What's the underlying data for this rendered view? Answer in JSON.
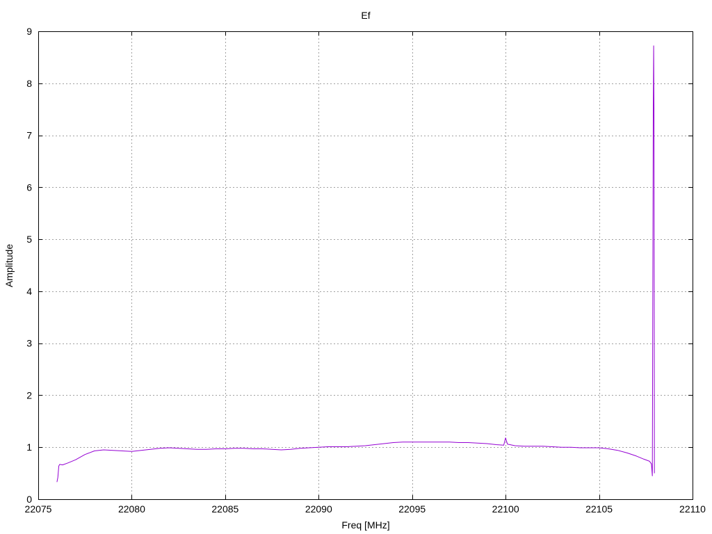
{
  "chart_data": {
    "type": "line",
    "title": "Ef",
    "xlabel": "Freq [MHz]",
    "ylabel": "Amplitude",
    "xlim": [
      22075,
      22110
    ],
    "ylim": [
      0,
      9
    ],
    "xticks": [
      22075,
      22080,
      22085,
      22090,
      22095,
      22100,
      22105,
      22110
    ],
    "yticks": [
      0,
      1,
      2,
      3,
      4,
      5,
      6,
      7,
      8,
      9
    ],
    "grid": true,
    "legend": "none",
    "series": [
      {
        "color": "#9400d3",
        "x": [
          22076.0,
          22076.05,
          22076.1,
          22076.15,
          22076.3,
          22076.6,
          22077.0,
          22077.5,
          22078.0,
          22078.5,
          22079.0,
          22079.5,
          22080.0,
          22080.5,
          22081.0,
          22081.5,
          22082.0,
          22082.5,
          22083.0,
          22083.5,
          22084.0,
          22084.5,
          22085.0,
          22085.5,
          22086.0,
          22086.5,
          22087.0,
          22087.5,
          22088.0,
          22088.5,
          22089.0,
          22089.5,
          22090.0,
          22090.5,
          22091.0,
          22091.5,
          22092.0,
          22092.5,
          22093.0,
          22093.5,
          22094.0,
          22094.5,
          22095.0,
          22095.5,
          22096.0,
          22096.5,
          22097.0,
          22097.5,
          22098.0,
          22098.5,
          22099.0,
          22099.5,
          22099.9,
          22100.0,
          22100.1,
          22100.5,
          22101.0,
          22101.5,
          22102.0,
          22102.5,
          22103.0,
          22103.5,
          22104.0,
          22104.5,
          22105.0,
          22105.5,
          22106.0,
          22106.5,
          22107.0,
          22107.4,
          22107.7,
          22107.8,
          22107.85,
          22107.9,
          22107.92,
          22107.94,
          22107.96
        ],
        "y": [
          0.33,
          0.42,
          0.64,
          0.67,
          0.66,
          0.7,
          0.76,
          0.86,
          0.93,
          0.95,
          0.94,
          0.93,
          0.92,
          0.94,
          0.96,
          0.98,
          0.99,
          0.98,
          0.97,
          0.96,
          0.96,
          0.97,
          0.97,
          0.98,
          0.98,
          0.97,
          0.97,
          0.96,
          0.95,
          0.96,
          0.98,
          0.99,
          1.0,
          1.01,
          1.01,
          1.01,
          1.02,
          1.03,
          1.05,
          1.07,
          1.09,
          1.1,
          1.1,
          1.1,
          1.1,
          1.1,
          1.1,
          1.09,
          1.09,
          1.08,
          1.07,
          1.05,
          1.04,
          1.18,
          1.06,
          1.03,
          1.02,
          1.02,
          1.02,
          1.01,
          1.0,
          1.0,
          0.99,
          0.99,
          0.99,
          0.97,
          0.94,
          0.89,
          0.83,
          0.77,
          0.73,
          0.68,
          0.45,
          7.4,
          8.72,
          7.4,
          0.5
        ]
      }
    ]
  }
}
